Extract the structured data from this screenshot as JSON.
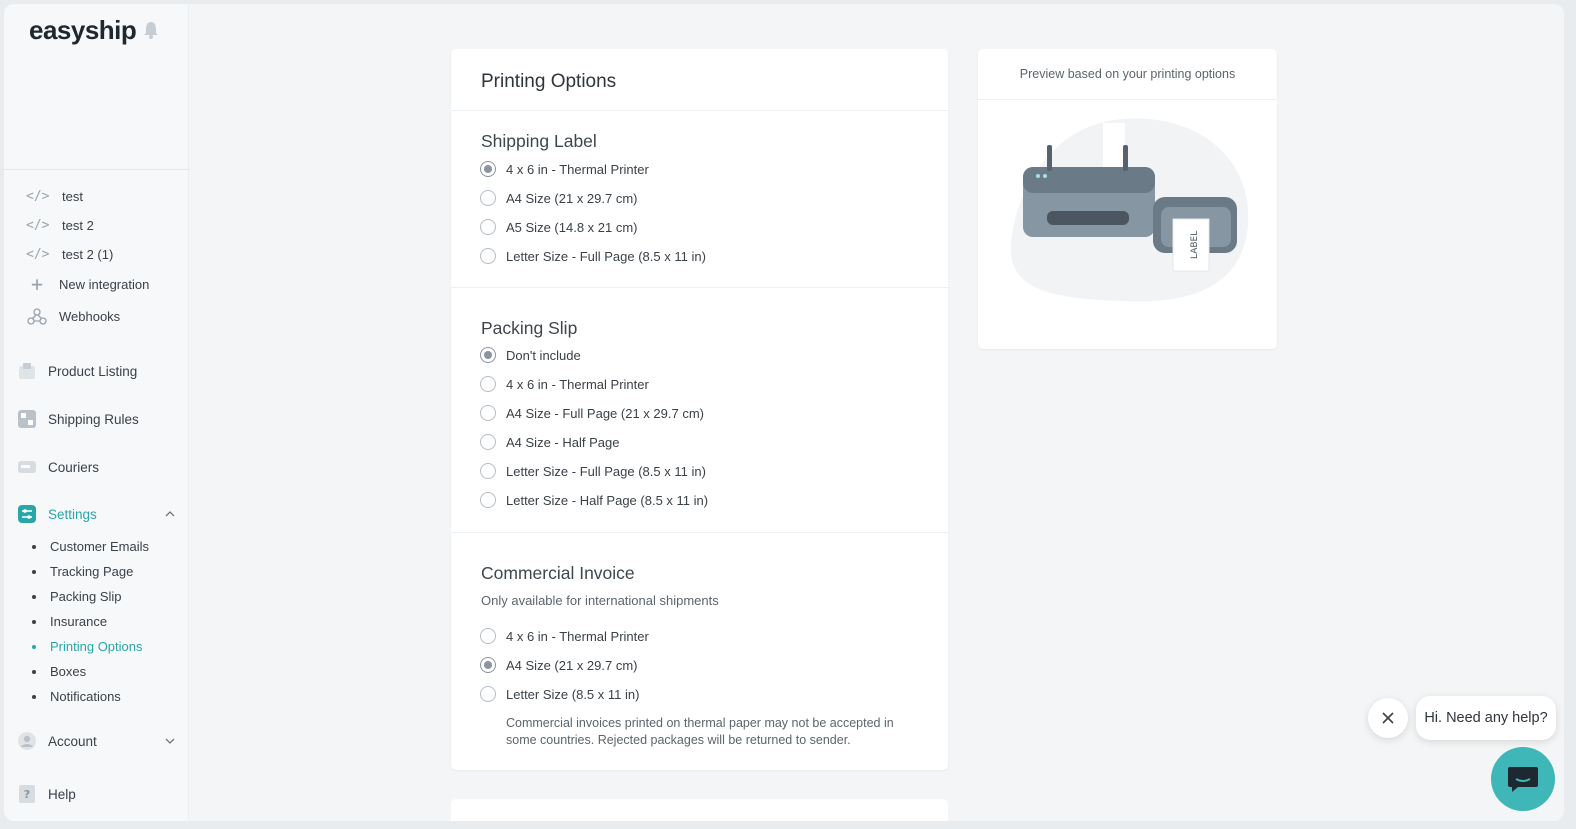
{
  "brand": {
    "name": "easyship"
  },
  "integrations": [
    {
      "label": "test",
      "icon": "code-icon"
    },
    {
      "label": "test 2",
      "icon": "code-icon"
    },
    {
      "label": "test 2 (1)",
      "icon": "code-icon"
    },
    {
      "label": "New integration",
      "icon": "plus-icon"
    },
    {
      "label": "Webhooks",
      "icon": "webhook-icon"
    }
  ],
  "nav": {
    "product_listing": "Product Listing",
    "shipping_rules": "Shipping Rules",
    "couriers": "Couriers",
    "settings": "Settings",
    "account": "Account",
    "help": "Help"
  },
  "settings_sub": [
    "Customer Emails",
    "Tracking Page",
    "Packing Slip",
    "Insurance",
    "Printing Options",
    "Boxes",
    "Notifications"
  ],
  "colors": {
    "accent": "#2aa6a9",
    "chat": "#3fb6b8"
  },
  "main": {
    "title": "Printing Options",
    "shipping_label": {
      "title": "Shipping Label",
      "options": [
        "4 x 6 in - Thermal Printer",
        "A4 Size (21 x 29.7 cm)",
        "A5 Size (14.8 x 21 cm)",
        "Letter Size - Full Page (8.5 x 11 in)"
      ],
      "selected": "4 x 6 in - Thermal Printer"
    },
    "packing_slip": {
      "title": "Packing Slip",
      "options": [
        "Don't include",
        "4 x 6 in - Thermal Printer",
        "A4 Size - Full Page (21 x 29.7 cm)",
        "A4 Size - Half Page",
        "Letter Size - Full Page (8.5 x 11 in)",
        "Letter Size - Half Page (8.5 x 11 in)"
      ],
      "selected": "Don't include"
    },
    "commercial_invoice": {
      "title": "Commercial Invoice",
      "subtitle": "Only available for international shipments",
      "options": [
        "4 x 6 in - Thermal Printer",
        "A4 Size (21 x 29.7 cm)",
        "Letter Size (8.5 x 11 in)"
      ],
      "selected": "A4 Size (21 x 29.7 cm)",
      "note": "Commercial invoices printed on thermal paper may not be accepted in some countries. Rejected packages will be returned to sender."
    }
  },
  "preview": {
    "title": "Preview based on your printing options",
    "label_text": "LABEL"
  },
  "chat": {
    "prompt": "Hi. Need any help?"
  }
}
